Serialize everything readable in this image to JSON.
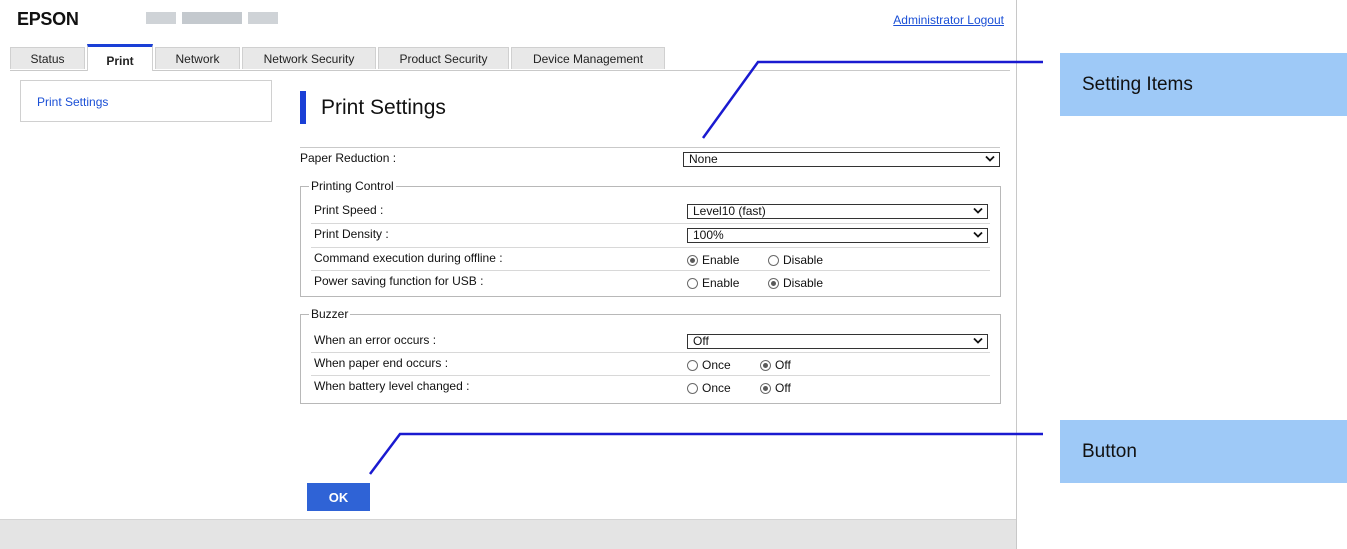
{
  "header": {
    "logo": "EPSON",
    "admin_logout": "Administrator Logout"
  },
  "tabs": [
    "Status",
    "Print",
    "Network",
    "Network Security",
    "Product Security",
    "Device Management"
  ],
  "active_tab": "Print",
  "sidebar": {
    "items": [
      "Print Settings"
    ]
  },
  "page": {
    "title": "Print Settings"
  },
  "paper_reduction": {
    "label": "Paper Reduction :",
    "value": "None"
  },
  "printing_control": {
    "legend": "Printing Control",
    "print_speed": {
      "label": "Print Speed :",
      "value": "Level10 (fast)"
    },
    "print_density": {
      "label": "Print Density :",
      "value": "100%"
    },
    "command_execution": {
      "label": "Command execution during offline :",
      "opt1": "Enable",
      "opt2": "Disable",
      "selected": "Enable"
    },
    "power_saving": {
      "label": "Power saving function for USB :",
      "opt1": "Enable",
      "opt2": "Disable",
      "selected": "Disable"
    }
  },
  "buzzer": {
    "legend": "Buzzer",
    "error": {
      "label": "When an error occurs :",
      "value": "Off"
    },
    "paper_end": {
      "label": "When paper end occurs :",
      "opt1": "Once",
      "opt2": "Off",
      "selected": "Off"
    },
    "battery": {
      "label": "When battery level changed :",
      "opt1": "Once",
      "opt2": "Off",
      "selected": "Off"
    }
  },
  "ok_button": "OK",
  "callouts": {
    "setting_items": "Setting Items",
    "button": "Button"
  },
  "colors": {
    "accent": "#1a3fd6",
    "button": "#2f63d6",
    "callout": "#9ec9f7",
    "link": "#1a4fd6"
  }
}
